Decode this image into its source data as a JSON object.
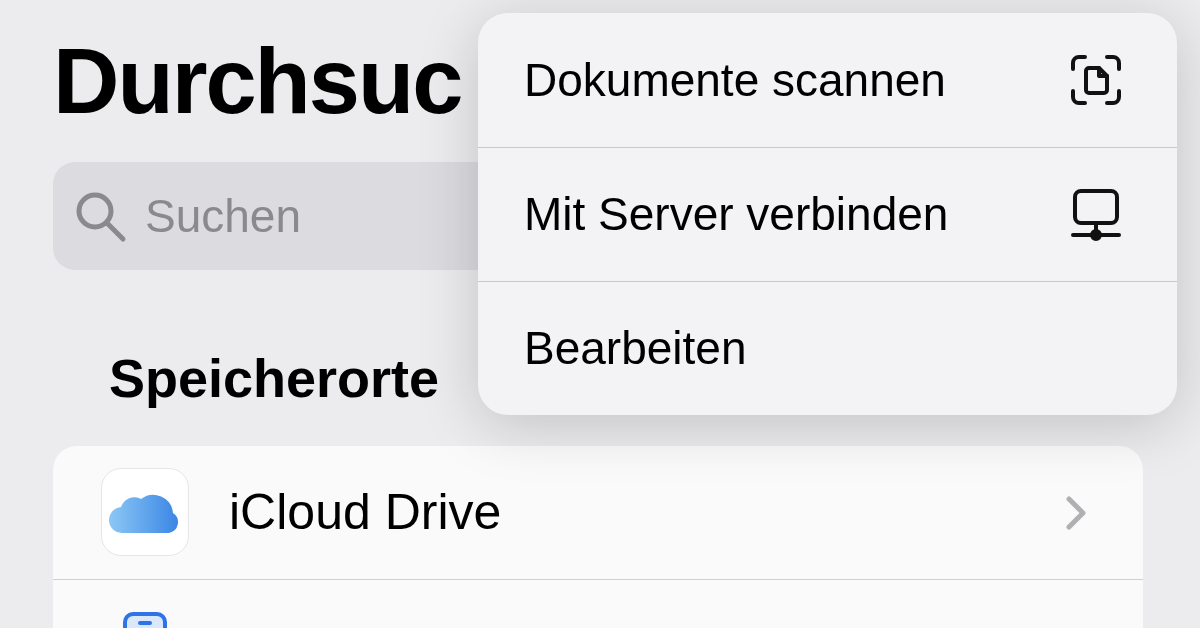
{
  "title": "Durchsuc",
  "search": {
    "placeholder": "Suchen"
  },
  "section_title": "Speicherorte",
  "locations": [
    {
      "kind": "icloud",
      "label": "iCloud Drive"
    },
    {
      "kind": "device"
    }
  ],
  "menu": [
    {
      "label": "Dokumente scannen",
      "kind": "scan"
    },
    {
      "label": "Mit Server verbinden",
      "kind": "server"
    },
    {
      "label": "Bearbeiten",
      "kind": "plain"
    }
  ]
}
